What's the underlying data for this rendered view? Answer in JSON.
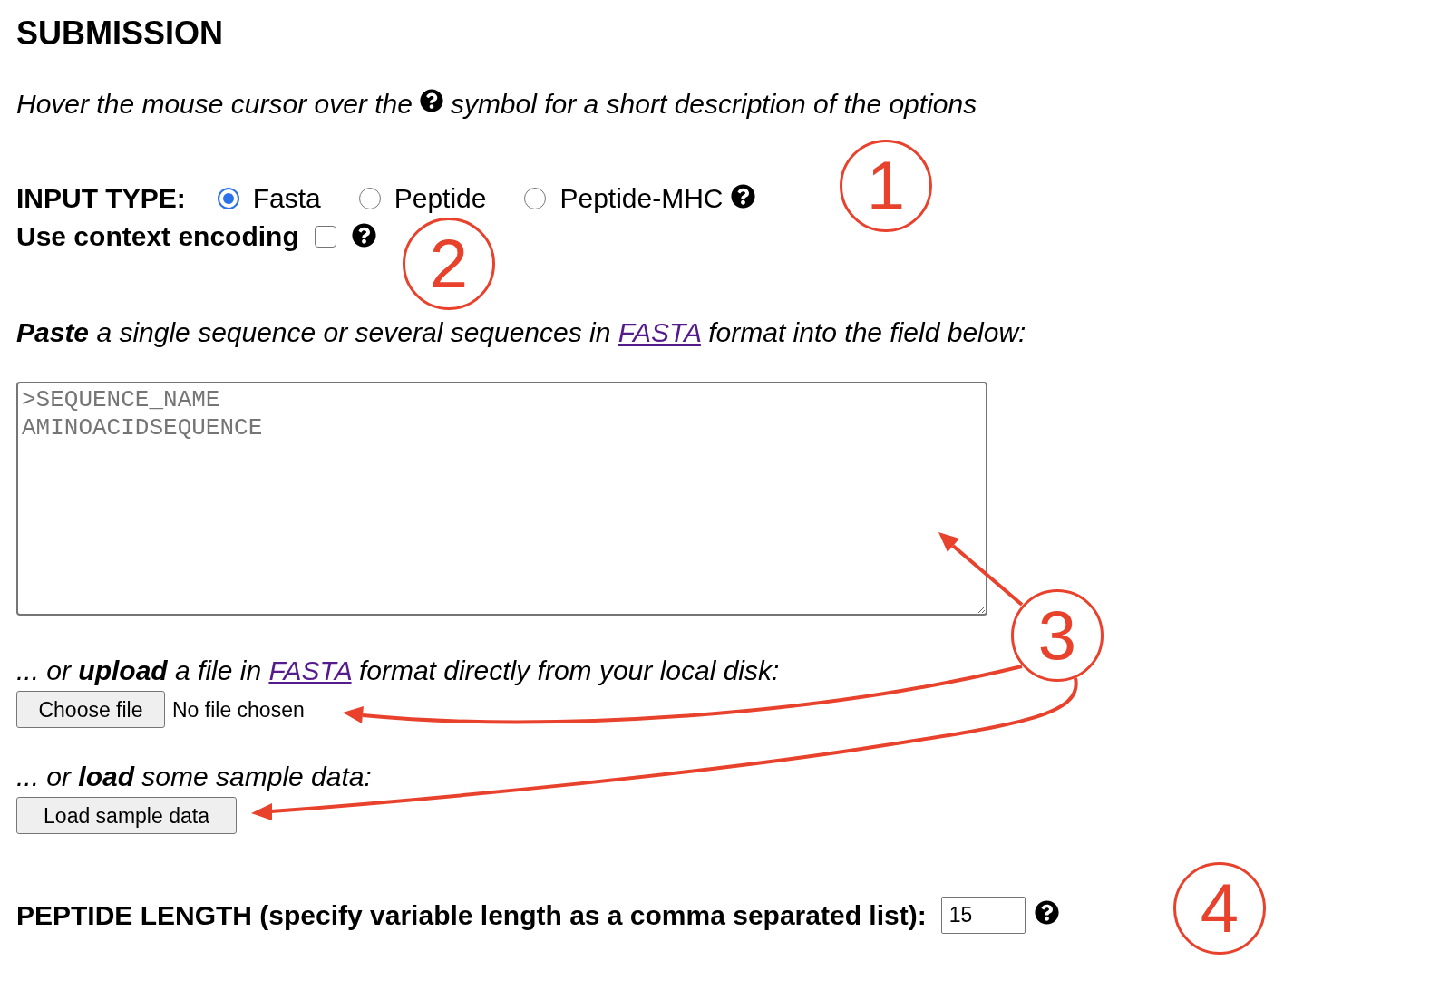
{
  "heading": "SUBMISSION",
  "hint": {
    "before": "Hover the mouse cursor over the",
    "after": "symbol for a short description of the options"
  },
  "input_type": {
    "label": "INPUT TYPE:",
    "options": [
      {
        "label": "Fasta",
        "selected": true
      },
      {
        "label": "Peptide",
        "selected": false
      },
      {
        "label": "Peptide-MHC",
        "selected": false
      }
    ]
  },
  "context_encoding": {
    "label": "Use context encoding",
    "checked": false
  },
  "paste_prompt": {
    "before": "**Paste** a single sequence or several sequences in",
    "link": "FASTA",
    "after": "format into the field below:"
  },
  "sequence_field": {
    "placeholder": ">SEQUENCE_NAME\nAMINOACIDSEQUENCE"
  },
  "upload": {
    "prompt": {
      "before": "... or **upload** a file in",
      "link": "FASTA",
      "after": "format directly from your local disk:"
    },
    "button": "Choose file",
    "status": "No file chosen"
  },
  "sample_data": {
    "prompt": "... or **load** some sample data:",
    "button": "Load sample data"
  },
  "peptide_length": {
    "label": "PEPTIDE LENGTH (specify variable length as a comma separated list):",
    "value": "15"
  },
  "annotations": {
    "markers": [
      "1",
      "2",
      "3",
      "4"
    ]
  }
}
